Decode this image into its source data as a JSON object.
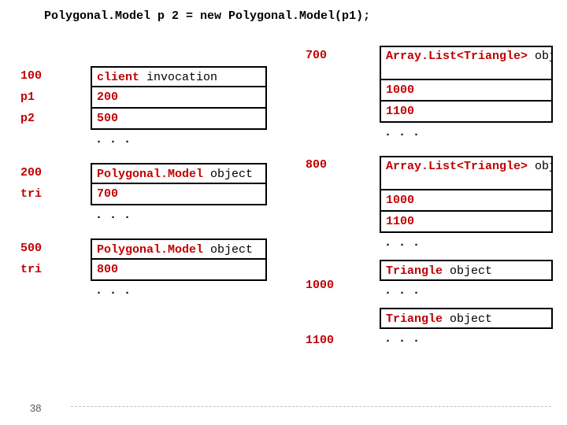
{
  "code_line": "Polygonal.Model p 2 = new Polygonal.Model(p1);",
  "labels": {
    "r0": "100",
    "r1": "p1",
    "r2": "p2",
    "r3": ". . .",
    "r4": "200",
    "r5": "tri",
    "r6": ". . .",
    "r7": "500",
    "r8": "tri",
    "r9": ". . ."
  },
  "colA": {
    "r0_pre": "client ",
    "r0_suf": "invocation",
    "r1": "200",
    "r2": "500",
    "r3": "",
    "r4_pre": "Polygonal.Model ",
    "r4_suf": "object",
    "r5": "700",
    "r6": "",
    "r7_pre": "Polygonal.Model ",
    "r7_suf": "object",
    "r8": "800",
    "r9": ""
  },
  "addr": {
    "a0": "700",
    "a1": "800",
    "a2": "1000",
    "a3": "1100"
  },
  "colB": {
    "b0_pre": "Array.List<Triangle> ",
    "b0_suf": "object",
    "b1": "1000",
    "b2": "1100",
    "b3": ". . .",
    "b4_pre": "Array.List<Triangle> ",
    "b4_suf": "object",
    "b5": "1000",
    "b6": "1100",
    "b7": ". . .",
    "b8_pre": "Triangle ",
    "b8_suf": "object",
    "b9": ". . .",
    "b10_pre": "Triangle ",
    "b10_suf": "object",
    "b11": ". . ."
  },
  "slide_num": "38"
}
